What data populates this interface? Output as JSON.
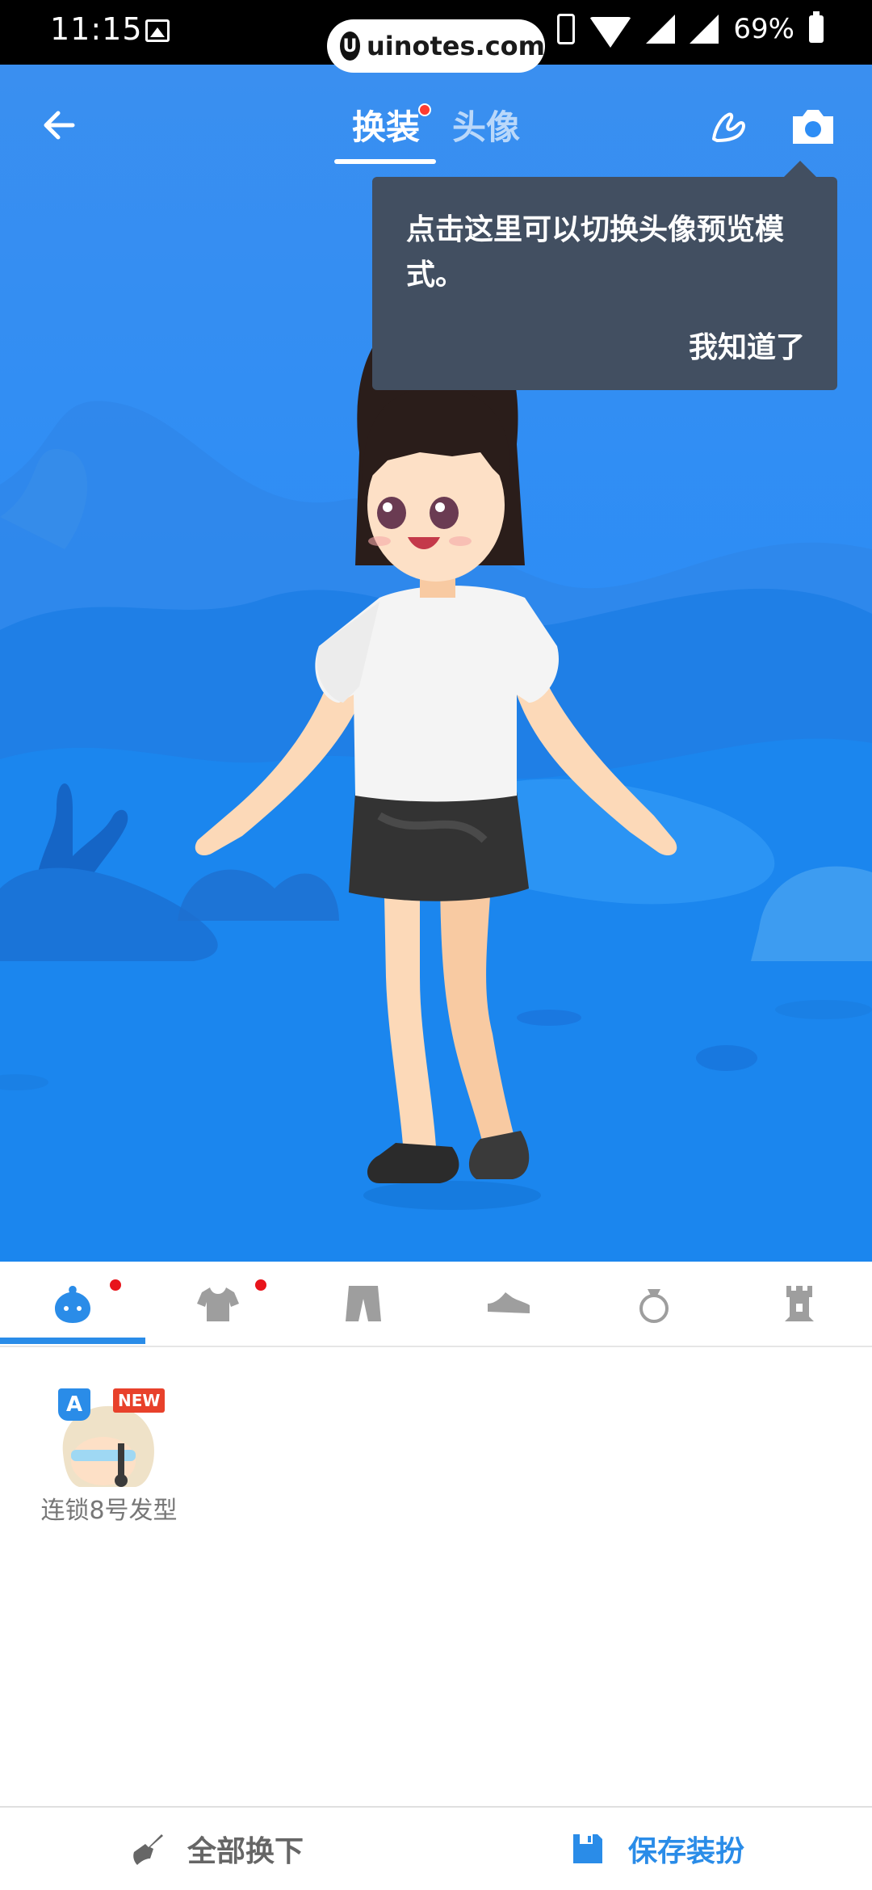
{
  "status_bar": {
    "time": "11:15",
    "url": "uinotes.com",
    "battery": "69%",
    "icons": [
      "gallery-icon",
      "vibrate-icon",
      "wifi-icon",
      "signal-icon",
      "battery-icon"
    ]
  },
  "header": {
    "back_icon": "arrow-left-icon",
    "tabs": [
      {
        "label": "换装",
        "active": true,
        "has_dot": true
      },
      {
        "label": "头像",
        "active": false,
        "has_dot": false
      }
    ],
    "edit_icon": "hand-gesture-icon",
    "camera_icon": "camera-icon"
  },
  "tooltip": {
    "text": "点击这里可以切换头像预览模式。",
    "confirm": "我知道了"
  },
  "categories": [
    {
      "icon": "face-icon",
      "active": true,
      "has_dot": true
    },
    {
      "icon": "shirt-icon",
      "active": false,
      "has_dot": true
    },
    {
      "icon": "pants-icon",
      "active": false,
      "has_dot": false
    },
    {
      "icon": "shoe-icon",
      "active": false,
      "has_dot": false
    },
    {
      "icon": "accessory-icon",
      "active": false,
      "has_dot": false
    },
    {
      "icon": "castle-icon",
      "active": false,
      "has_dot": false
    }
  ],
  "items": [
    {
      "label": "连锁8号发型",
      "badge": "A",
      "tag": "NEW"
    }
  ],
  "actions": {
    "undress_all": "全部换下",
    "save_outfit": "保存装扮"
  },
  "colors": {
    "accent": "#2a8ce8",
    "sky": "#2d8df5",
    "tooltip_bg": "#424f61",
    "notification_dot": "#e8141b",
    "new_badge": "#e8412b"
  }
}
